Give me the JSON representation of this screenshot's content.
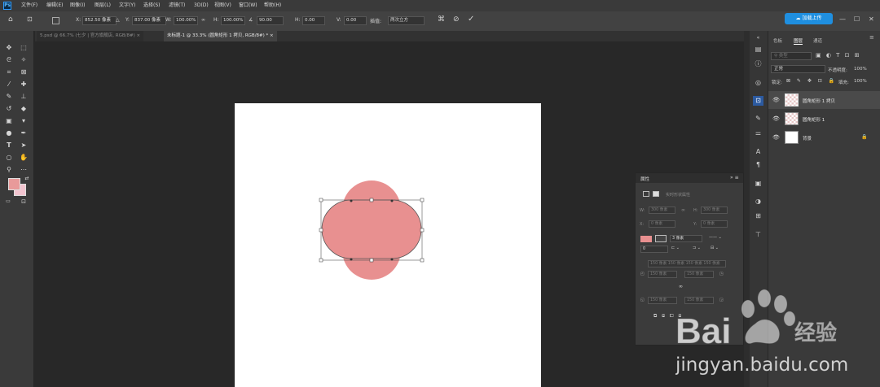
{
  "menu": {
    "app_icon": "Ps",
    "items": [
      "文件(F)",
      "编辑(E)",
      "图像(I)",
      "图层(L)",
      "文字(Y)",
      "选择(S)",
      "滤镜(T)",
      "3D(D)",
      "视图(V)",
      "窗口(W)",
      "帮助(H)"
    ]
  },
  "options": {
    "x_label": "X:",
    "x_value": "852.50 像素",
    "y_label": "Y:",
    "y_value": "837.00 像素",
    "w_label": "W:",
    "w_value": "100.00%",
    "h_label": "H:",
    "h_value": "100.00%",
    "angle_value": "90.00",
    "hskew_label": "H:",
    "hskew_value": "0.00",
    "vskew_label": "V:",
    "vskew_value": "0.00",
    "interp_label": "插值:",
    "interp_value": "两次立方",
    "cloud_button": "加载上传"
  },
  "tabs": [
    {
      "label": "5.psd @ 66.7% (七夕 | 官方旗舰店, RGB/8#) ×",
      "active": false
    },
    {
      "label": "未标题-1 @ 33.3% (圆角矩形 1 拷贝, RGB/8#) * ×",
      "active": true
    }
  ],
  "layers_panel": {
    "tabs": [
      "色板",
      "图层",
      "通道"
    ],
    "search_placeholder": "类型",
    "blend_mode": "正常",
    "opacity_label": "不透明度:",
    "opacity_value": "100%",
    "lock_label": "锁定:",
    "fill_label": "填充:",
    "fill_value": "100%",
    "layers": [
      {
        "name": "圆角矩形 1 拷贝",
        "type": "shape",
        "selected": true
      },
      {
        "name": "圆角矩形 1",
        "type": "shape",
        "selected": false
      },
      {
        "name": "背景",
        "type": "background",
        "selected": false
      }
    ]
  },
  "properties_panel": {
    "title": "属性",
    "subtitle": "实时形状属性",
    "w_label": "W:",
    "w_value": "300 像素",
    "h_label": "H:",
    "h_value": "300 像素",
    "x_label": "X:",
    "x_value": "0 像素",
    "y_label": "Y:",
    "y_value": "0 像素",
    "stroke_width": "3 像素",
    "stroke_count": "0",
    "corner_radius_all": "150 像素 150 像素 150 像素 150 像素",
    "corner_tl": "150 像素",
    "corner_tr": "150 像素",
    "corner_bl": "150 像素",
    "corner_br": "150 像素"
  },
  "colors": {
    "shape_fill": "#e89090",
    "foreground": "#e89a9a",
    "background": "#f2c4cf",
    "accent": "#1f8fe0"
  },
  "watermark": {
    "brand": "Bai",
    "brand_suffix": "经验",
    "url": "jingyan.baidu.com"
  }
}
